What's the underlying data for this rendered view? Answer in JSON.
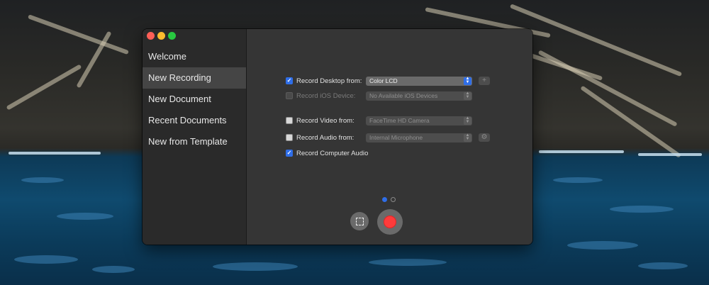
{
  "window": {
    "traffic_lights": [
      "close",
      "minimize",
      "zoom"
    ]
  },
  "sidebar": {
    "items": [
      {
        "label": "Welcome",
        "selected": false
      },
      {
        "label": "New Recording",
        "selected": true
      },
      {
        "label": "New Document",
        "selected": false
      },
      {
        "label": "Recent Documents",
        "selected": false
      },
      {
        "label": "New from Template",
        "selected": false
      }
    ]
  },
  "options": {
    "desktop": {
      "label": "Record Desktop from:",
      "checked": true,
      "enabled": true,
      "value": "Color LCD",
      "side_icon": "plus-icon"
    },
    "ios": {
      "label": "Record iOS Device:",
      "checked": false,
      "enabled": false,
      "value": "No Available iOS Devices"
    },
    "video": {
      "label": "Record Video from:",
      "checked": false,
      "enabled": true,
      "value": "FaceTime HD Camera"
    },
    "audio": {
      "label": "Record Audio from:",
      "checked": false,
      "enabled": true,
      "value": "Internal Microphone",
      "side_icon": "gear-icon"
    },
    "computer_audio": {
      "label": "Record Computer Audio",
      "checked": true,
      "enabled": true
    }
  },
  "pager": {
    "pages": 2,
    "current": 1
  },
  "controls": {
    "select_area_icon": "dashed-rect-icon",
    "record_icon": "record-icon"
  },
  "colors": {
    "accent": "#2f6ee8",
    "record": "#ff3b3b",
    "close": "#fe5f57",
    "minimize": "#febb2e",
    "zoom": "#28c840"
  }
}
